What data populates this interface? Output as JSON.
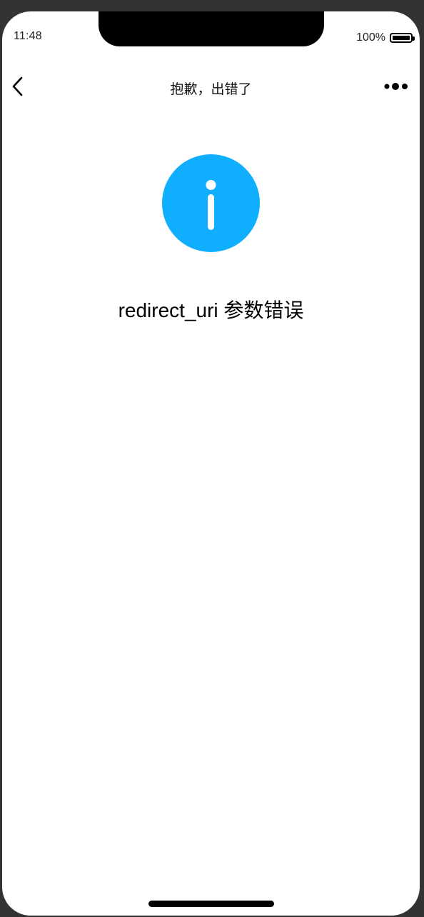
{
  "status_bar": {
    "time": "11:48",
    "battery_percent": "100%",
    "battery_level": 1.0
  },
  "navbar": {
    "title": "抱歉，出错了",
    "back_icon": "chevron-left-icon",
    "more_icon": "more-dots-icon"
  },
  "content": {
    "icon": "info-circle-icon",
    "icon_color": "#10AEFF",
    "message": "redirect_uri 参数错误"
  }
}
